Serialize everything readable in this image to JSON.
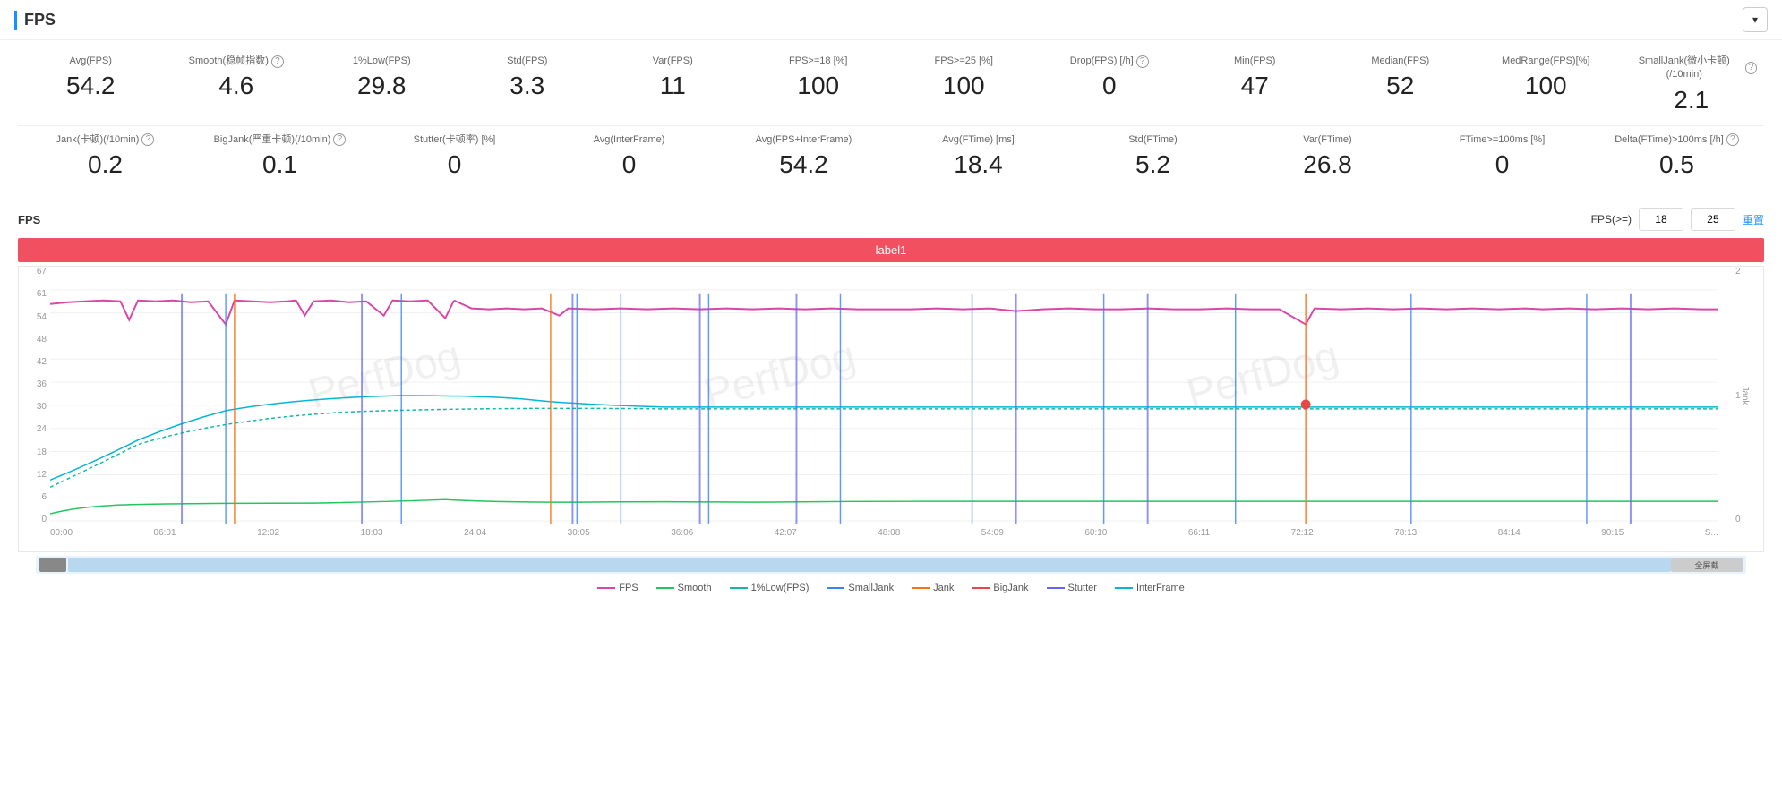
{
  "header": {
    "title": "FPS",
    "collapse_icon": "▾"
  },
  "metrics_row1": [
    {
      "id": "avg-fps",
      "label": "Avg(FPS)",
      "value": "54.2",
      "help": false
    },
    {
      "id": "smooth",
      "label": "Smooth(稳帧指数)",
      "value": "4.6",
      "help": true
    },
    {
      "id": "low1pct",
      "label": "1%Low(FPS)",
      "value": "29.8",
      "help": false
    },
    {
      "id": "std-fps",
      "label": "Std(FPS)",
      "value": "3.3",
      "help": false
    },
    {
      "id": "var-fps",
      "label": "Var(FPS)",
      "value": "11",
      "help": false
    },
    {
      "id": "fps18",
      "label": "FPS>=18 [%]",
      "value": "100",
      "help": false
    },
    {
      "id": "fps25",
      "label": "FPS>=25 [%]",
      "value": "100",
      "help": false
    },
    {
      "id": "drop-fps",
      "label": "Drop(FPS) [/h]",
      "value": "0",
      "help": true
    },
    {
      "id": "min-fps",
      "label": "Min(FPS)",
      "value": "47",
      "help": false
    },
    {
      "id": "median-fps",
      "label": "Median(FPS)",
      "value": "52",
      "help": false
    },
    {
      "id": "medrange-fps",
      "label": "MedRange(FPS)[%]",
      "value": "100",
      "help": false
    },
    {
      "id": "smalljank",
      "label": "SmallJank(微小卡顿)(/10min)",
      "value": "2.1",
      "help": true
    }
  ],
  "metrics_row2": [
    {
      "id": "jank",
      "label": "Jank(卡顿)(/10min)",
      "value": "0.2",
      "help": true
    },
    {
      "id": "bigjank",
      "label": "BigJank(严重卡顿)(/10min)",
      "value": "0.1",
      "help": true
    },
    {
      "id": "stutter",
      "label": "Stutter(卡顿率) [%]",
      "value": "0",
      "help": false
    },
    {
      "id": "avg-interframe",
      "label": "Avg(InterFrame)",
      "value": "0",
      "help": false
    },
    {
      "id": "avg-fps-interframe",
      "label": "Avg(FPS+InterFrame)",
      "value": "54.2",
      "help": false
    },
    {
      "id": "avg-ftime",
      "label": "Avg(FTime) [ms]",
      "value": "18.4",
      "help": false
    },
    {
      "id": "std-ftime",
      "label": "Std(FTime)",
      "value": "5.2",
      "help": false
    },
    {
      "id": "var-ftime",
      "label": "Var(FTime)",
      "value": "26.8",
      "help": false
    },
    {
      "id": "ftime100",
      "label": "FTime>=100ms [%]",
      "value": "0",
      "help": false
    },
    {
      "id": "delta-ftime",
      "label": "Delta(FTime)>100ms [/h]",
      "value": "0.5",
      "help": true
    }
  ],
  "chart": {
    "title": "FPS",
    "fps_filter_label": "FPS(>=)",
    "fps_value1": "18",
    "fps_value2": "25",
    "reset_label": "重置",
    "label_bar": "label1",
    "y_axis_left": [
      "67",
      "61",
      "54",
      "48",
      "42",
      "36",
      "30",
      "24",
      "18",
      "12",
      "6",
      "0"
    ],
    "y_axis_right": [
      "2",
      "1",
      "0"
    ],
    "y_right_label": "Jank",
    "x_axis": [
      "00:00",
      "06:01",
      "12:02",
      "18:03",
      "24:04",
      "30:05",
      "36:06",
      "42:07",
      "48:08",
      "54:09",
      "60:10",
      "66:11",
      "72:12",
      "78:13",
      "84:14",
      "90:15",
      "S..."
    ]
  },
  "legend": [
    {
      "id": "fps-legend",
      "label": "FPS",
      "color": "#d946a8",
      "type": "line"
    },
    {
      "id": "smooth-legend",
      "label": "Smooth",
      "color": "#22c55e",
      "type": "line"
    },
    {
      "id": "low1pct-legend",
      "label": "1%Low(FPS)",
      "color": "#14b8a6",
      "type": "line"
    },
    {
      "id": "smalljank-legend",
      "label": "SmallJank",
      "color": "#3b82f6",
      "type": "line"
    },
    {
      "id": "jank-legend",
      "label": "Jank",
      "color": "#f97316",
      "type": "line"
    },
    {
      "id": "bigjank-legend",
      "label": "BigJank",
      "color": "#ef4444",
      "type": "line"
    },
    {
      "id": "stutter-legend",
      "label": "Stutter",
      "color": "#6366f1",
      "type": "line"
    },
    {
      "id": "interframe-legend",
      "label": "InterFrame",
      "color": "#06b6d4",
      "type": "line"
    }
  ],
  "bottom": {
    "full_screen_label": "全屏截"
  }
}
